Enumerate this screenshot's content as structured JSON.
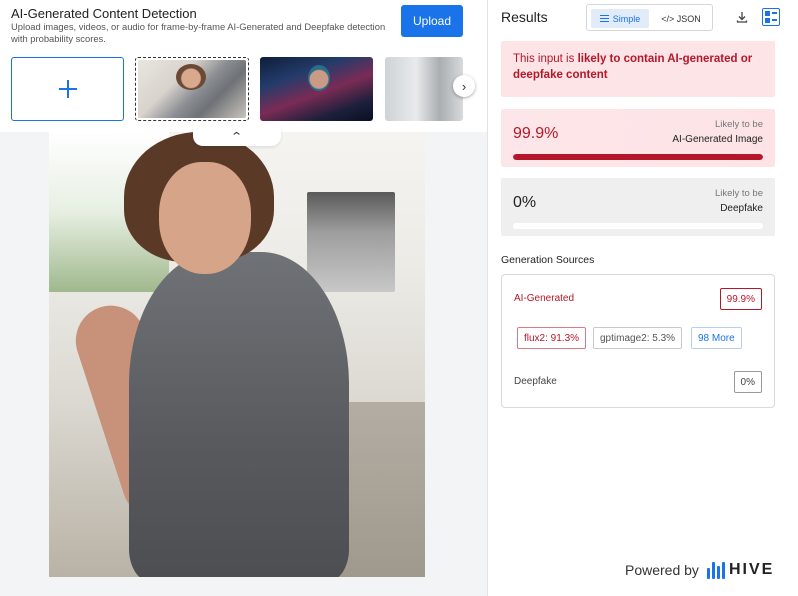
{
  "header": {
    "title": "AI-Generated Content Detection",
    "subtitle": "Upload images, videos, or audio for frame-by-frame AI-Generated and Deepfake detection with probability scores.",
    "upload_label": "Upload"
  },
  "gallery": {
    "add_icon": "plus-icon",
    "next_icon": "chevron-right-icon",
    "collapse_icon": "chevron-up-icon",
    "next_glyph": "›",
    "collapse_glyph": "⌃"
  },
  "results": {
    "title": "Results",
    "view_toggle": {
      "simple_label": "Simple",
      "json_label": "</> JSON",
      "selected": "Simple"
    },
    "verdict": {
      "prefix": "This input is ",
      "emphasis": "likely to contain AI-generated or deepfake content"
    },
    "scores": [
      {
        "value_text": "99.9%",
        "value": 0.999,
        "likely_label": "Likely to be",
        "target": "AI-Generated Image"
      },
      {
        "value_text": "0%",
        "value": 0.0,
        "likely_label": "Likely to be",
        "target": "Deepfake"
      }
    ],
    "generation_sources": {
      "title": "Generation Sources",
      "ai_label": "AI-Generated",
      "ai_value": "99.9%",
      "chips": [
        "flux2: 91.3%",
        "gptimage2: 5.3%",
        "98 More"
      ],
      "deepfake_label": "Deepfake",
      "deepfake_value": "0%"
    }
  },
  "footer": {
    "powered_by": "Powered by",
    "brand": "HIVE"
  },
  "colors": {
    "accent": "#1a73e8",
    "danger": "#b5172a",
    "danger_bg": "#fde4e6"
  }
}
